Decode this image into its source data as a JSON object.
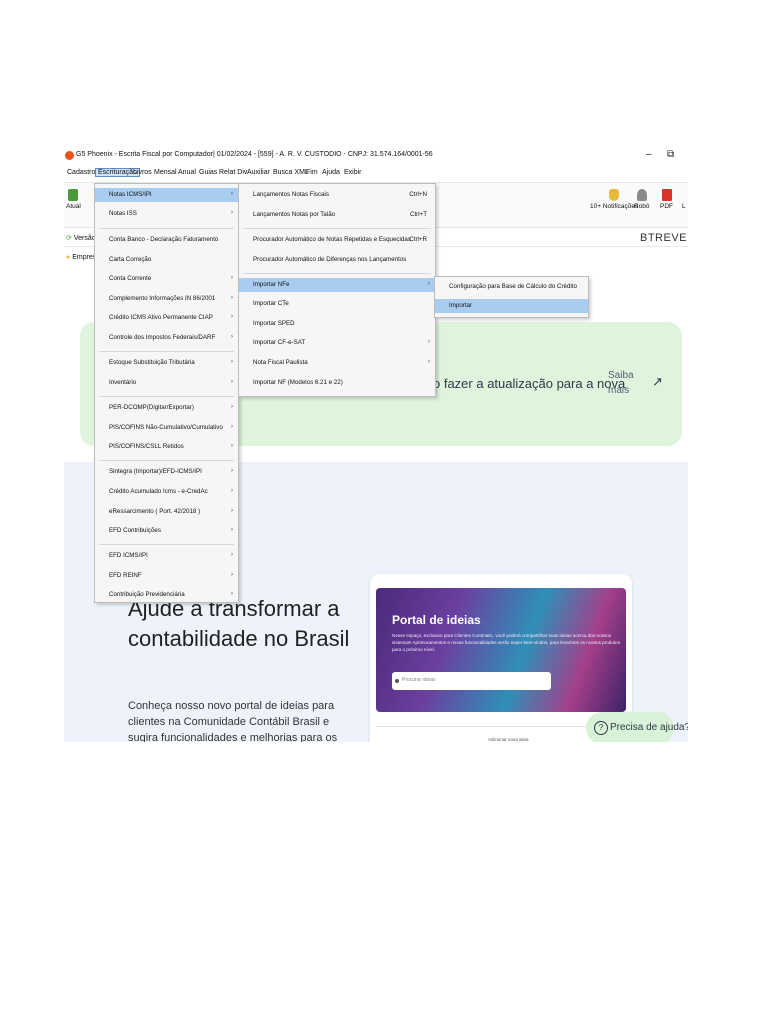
{
  "window": {
    "title": "G5 Phoenix - Escrita Fiscal por Computador| 01/02/2024 - [559] - A. R. V. CUSTODIO - CNPJ: 31.574.164/0001-56",
    "minimize": "–",
    "restore": "⧉"
  },
  "menubar": [
    "Cadastro",
    "Escrituração",
    "Livros",
    "Mensal",
    "Anual",
    "Guias",
    "Relat Div",
    "Auxiliar",
    "Busca XML",
    "Fim",
    "Ajuda",
    "Exibir"
  ],
  "toolbar": {
    "left_btn": "Atual",
    "notifications": "10+ Notificações",
    "robot": "Robô",
    "pdf": "PDF",
    "extra": "L"
  },
  "row2": {
    "version": "Versão",
    "brand": "BTREVE"
  },
  "row3": {
    "company": "Empres"
  },
  "banner": {
    "text": "o fazer a atualização para a nova",
    "link": "Saiba mais",
    "arrow": "↗"
  },
  "lower": {
    "heading": "Ajude a transformar a contabilidade no Brasil",
    "paragraph": "Conheça nosso novo portal de ideias para clientes na Comunidade Contábil Brasil e sugira funcionalidades e melhorias para os sistemas Folha, Fiscal e Contábil."
  },
  "card": {
    "title": "Portal de ideias",
    "subtitle": "Nesse espaço, exclusivo para Clientes Contmatic, você poderá compartilhar suas ideias acerca dos nossos sistemas! Aprimoramentos e novas funcionalidades serão super bem-vindos, para levarmos os nossos produtos para o próximo nível.",
    "search_placeholder": "Procurar ideias",
    "strip": "Adicionar nova ideia"
  },
  "help": {
    "label": "Precisa de ajuda?",
    "icon": "?"
  },
  "menu1": [
    {
      "label": "Notas ICMS/IPI",
      "sub": true
    },
    {
      "label": "Notas ISS",
      "sub": true
    },
    {
      "label": "Conta Banco - Declaração Faturamento",
      "sub": false
    },
    {
      "label": "Carta Correção",
      "sub": false
    },
    {
      "label": "Conta Corrente",
      "sub": true
    },
    {
      "label": "Complemento Informações IN 86/2001",
      "sub": true
    },
    {
      "label": "Crédito ICMS Ativo Permanente CIAP",
      "sub": true
    },
    {
      "label": "Controle dos Impostos Federais/DARF",
      "sub": true
    },
    {
      "label": "Estoque Substituição Tributária",
      "sub": true
    },
    {
      "label": "Inventário",
      "sub": true
    },
    {
      "label": "PER-DCOMP(Digitar/Exportar)",
      "sub": true
    },
    {
      "label": "PIS/COFINS Não-Cumulativo/Cumulativo",
      "sub": true
    },
    {
      "label": "PIS/COFINS/CSLL Retidos",
      "sub": true
    },
    {
      "label": "Sintegra (Importar)/EFD-ICMS/IPI",
      "sub": true
    },
    {
      "label": "Crédito Acumulado Icms - e-CredAc",
      "sub": true
    },
    {
      "label": "eRessarcimento ( Port. 42/2018 )",
      "sub": true
    },
    {
      "label": "EFD Contribuições",
      "sub": true
    },
    {
      "label": "EFD ICMS/IPI",
      "sub": true
    },
    {
      "label": "EFD REINF",
      "sub": true
    },
    {
      "label": "Contribuição Previdenciária",
      "sub": true
    }
  ],
  "menu2": [
    {
      "label": "Lançamentos Notas Fiscais",
      "shortcut": "Ctrl+N",
      "sub": false
    },
    {
      "label": "Lançamentos Notas por Talão",
      "shortcut": "Ctrl+T",
      "sub": false
    },
    {
      "label": "Procurador Automático de Notas Repetidas e Esquecidas",
      "shortcut": "Ctrl+R",
      "sub": false
    },
    {
      "label": "Procurador Automático de Diferenças nos Lançamentos",
      "shortcut": "",
      "sub": false
    },
    {
      "label": "Importar NFe",
      "shortcut": "",
      "sub": true
    },
    {
      "label": "Importar CTe",
      "shortcut": "",
      "sub": false
    },
    {
      "label": "Importar SPED",
      "shortcut": "",
      "sub": false
    },
    {
      "label": "Importar CF-e-SAT",
      "shortcut": "",
      "sub": true
    },
    {
      "label": "Nota Fiscal Paulista",
      "shortcut": "",
      "sub": true
    },
    {
      "label": "Importar NF (Modelos 6.21 e 22)",
      "shortcut": "",
      "sub": false
    }
  ],
  "menu3": [
    {
      "label": "Configuração para Base de Cálculo do Crédito"
    },
    {
      "label": "Importar"
    }
  ],
  "arrow_glyph": "›",
  "colors": {
    "menu_highlight": "#a9cdf1",
    "banner_bg": "#dff4dd",
    "lower_bg": "#eef3fb"
  }
}
